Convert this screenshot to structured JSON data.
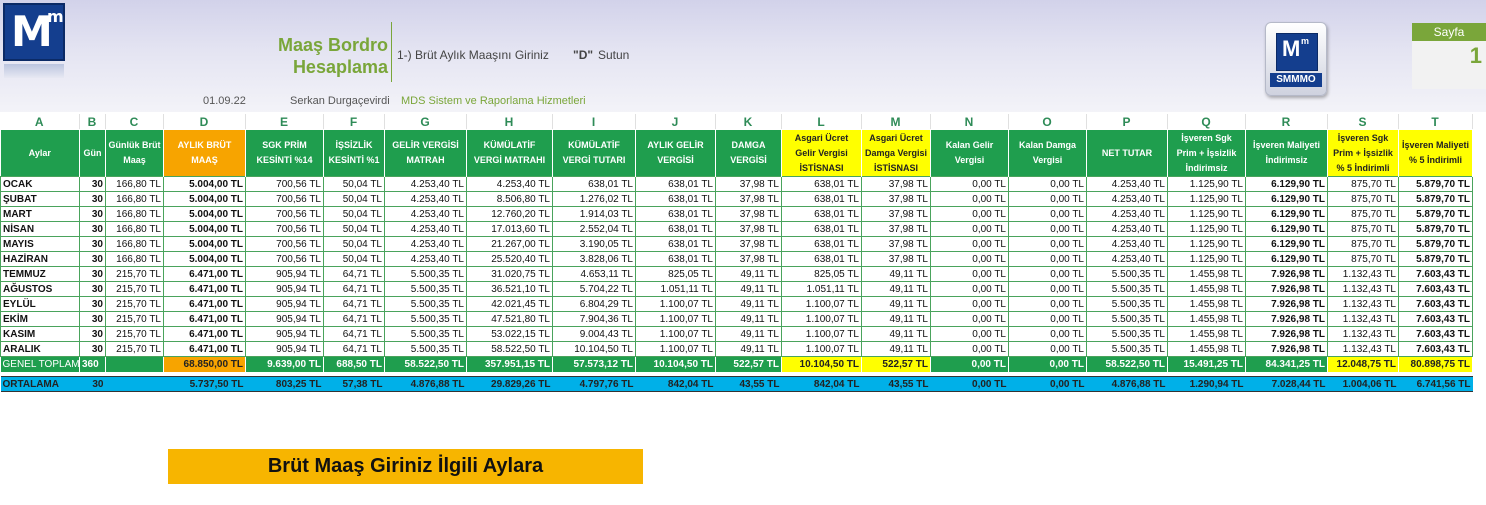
{
  "header": {
    "title_line1": "Maaş Bordro",
    "title_line2": "Hesaplama",
    "instruction": "1-) Brüt Aylık Maaşını Giriniz",
    "instruction_col": "\"D\"",
    "instruction_suffix": "Sutun",
    "date": "01.09.22",
    "author": "Serkan Durgaçevirdi",
    "company": "MDS Sistem ve Raporlama Hizmetleri",
    "logo_text": "M",
    "logo_sup": "m",
    "logo2_text": "SMMMO",
    "page_label": "Sayfa",
    "page_number": "1"
  },
  "column_letters": [
    "A",
    "B",
    "C",
    "D",
    "E",
    "F",
    "G",
    "H",
    "I",
    "J",
    "K",
    "L",
    "M",
    "N",
    "O",
    "P",
    "Q",
    "R",
    "S",
    "T"
  ],
  "column_headers": [
    "Aylar",
    "Gün",
    "Günlük Brüt Maaş",
    "AYLIK BRÜT MAAŞ",
    "SGK PRİM KESİNTİ %14",
    "İŞSİZLİK KESİNTİ %1",
    "GELİR VERGİSİ MATRAH",
    "KÜMÜLATİF VERGİ MATRAHI",
    "KÜMÜLATİF VERGİ TUTARI",
    "AYLIK GELİR VERGİSİ",
    "DAMGA VERGİSİ",
    "Asgari Ücret Gelir Vergisi İSTİSNASI",
    "Asgari Ücret Damga Vergisi İSTİSNASI",
    "Kalan Gelir Vergisi",
    "Kalan Damga Vergisi",
    "NET TUTAR",
    "İşveren Sgk Prim + İşsizlik İndirimsiz",
    "İşveren Maliyeti İndirimsiz",
    "İşveren Sgk Prim + İşsizlik % 5 İndirimli",
    "İşveren Maliyeti % 5 İndirimli"
  ],
  "rows": [
    [
      "OCAK",
      "30",
      "166,80 TL",
      "5.004,00 TL",
      "700,56 TL",
      "50,04 TL",
      "4.253,40 TL",
      "4.253,40 TL",
      "638,01 TL",
      "638,01 TL",
      "37,98 TL",
      "638,01 TL",
      "37,98 TL",
      "0,00 TL",
      "0,00 TL",
      "4.253,40 TL",
      "1.125,90 TL",
      "6.129,90 TL",
      "875,70 TL",
      "5.879,70 TL"
    ],
    [
      "ŞUBAT",
      "30",
      "166,80 TL",
      "5.004,00 TL",
      "700,56 TL",
      "50,04 TL",
      "4.253,40 TL",
      "8.506,80 TL",
      "1.276,02 TL",
      "638,01 TL",
      "37,98 TL",
      "638,01 TL",
      "37,98 TL",
      "0,00 TL",
      "0,00 TL",
      "4.253,40 TL",
      "1.125,90 TL",
      "6.129,90 TL",
      "875,70 TL",
      "5.879,70 TL"
    ],
    [
      "MART",
      "30",
      "166,80 TL",
      "5.004,00 TL",
      "700,56 TL",
      "50,04 TL",
      "4.253,40 TL",
      "12.760,20 TL",
      "1.914,03 TL",
      "638,01 TL",
      "37,98 TL",
      "638,01 TL",
      "37,98 TL",
      "0,00 TL",
      "0,00 TL",
      "4.253,40 TL",
      "1.125,90 TL",
      "6.129,90 TL",
      "875,70 TL",
      "5.879,70 TL"
    ],
    [
      "NİSAN",
      "30",
      "166,80 TL",
      "5.004,00 TL",
      "700,56 TL",
      "50,04 TL",
      "4.253,40 TL",
      "17.013,60 TL",
      "2.552,04 TL",
      "638,01 TL",
      "37,98 TL",
      "638,01 TL",
      "37,98 TL",
      "0,00 TL",
      "0,00 TL",
      "4.253,40 TL",
      "1.125,90 TL",
      "6.129,90 TL",
      "875,70 TL",
      "5.879,70 TL"
    ],
    [
      "MAYIS",
      "30",
      "166,80 TL",
      "5.004,00 TL",
      "700,56 TL",
      "50,04 TL",
      "4.253,40 TL",
      "21.267,00 TL",
      "3.190,05 TL",
      "638,01 TL",
      "37,98 TL",
      "638,01 TL",
      "37,98 TL",
      "0,00 TL",
      "0,00 TL",
      "4.253,40 TL",
      "1.125,90 TL",
      "6.129,90 TL",
      "875,70 TL",
      "5.879,70 TL"
    ],
    [
      "HAZİRAN",
      "30",
      "166,80 TL",
      "5.004,00 TL",
      "700,56 TL",
      "50,04 TL",
      "4.253,40 TL",
      "25.520,40 TL",
      "3.828,06 TL",
      "638,01 TL",
      "37,98 TL",
      "638,01 TL",
      "37,98 TL",
      "0,00 TL",
      "0,00 TL",
      "4.253,40 TL",
      "1.125,90 TL",
      "6.129,90 TL",
      "875,70 TL",
      "5.879,70 TL"
    ],
    [
      "TEMMUZ",
      "30",
      "215,70 TL",
      "6.471,00 TL",
      "905,94 TL",
      "64,71 TL",
      "5.500,35 TL",
      "31.020,75 TL",
      "4.653,11 TL",
      "825,05 TL",
      "49,11 TL",
      "825,05 TL",
      "49,11 TL",
      "0,00 TL",
      "0,00 TL",
      "5.500,35 TL",
      "1.455,98 TL",
      "7.926,98 TL",
      "1.132,43 TL",
      "7.603,43 TL"
    ],
    [
      "AĞUSTOS",
      "30",
      "215,70 TL",
      "6.471,00 TL",
      "905,94 TL",
      "64,71 TL",
      "5.500,35 TL",
      "36.521,10 TL",
      "5.704,22 TL",
      "1.051,11 TL",
      "49,11 TL",
      "1.051,11 TL",
      "49,11 TL",
      "0,00 TL",
      "0,00 TL",
      "5.500,35 TL",
      "1.455,98 TL",
      "7.926,98 TL",
      "1.132,43 TL",
      "7.603,43 TL"
    ],
    [
      "EYLÜL",
      "30",
      "215,70 TL",
      "6.471,00 TL",
      "905,94 TL",
      "64,71 TL",
      "5.500,35 TL",
      "42.021,45 TL",
      "6.804,29 TL",
      "1.100,07 TL",
      "49,11 TL",
      "1.100,07 TL",
      "49,11 TL",
      "0,00 TL",
      "0,00 TL",
      "5.500,35 TL",
      "1.455,98 TL",
      "7.926,98 TL",
      "1.132,43 TL",
      "7.603,43 TL"
    ],
    [
      "EKİM",
      "30",
      "215,70 TL",
      "6.471,00 TL",
      "905,94 TL",
      "64,71 TL",
      "5.500,35 TL",
      "47.521,80 TL",
      "7.904,36 TL",
      "1.100,07 TL",
      "49,11 TL",
      "1.100,07 TL",
      "49,11 TL",
      "0,00 TL",
      "0,00 TL",
      "5.500,35 TL",
      "1.455,98 TL",
      "7.926,98 TL",
      "1.132,43 TL",
      "7.603,43 TL"
    ],
    [
      "KASIM",
      "30",
      "215,70 TL",
      "6.471,00 TL",
      "905,94 TL",
      "64,71 TL",
      "5.500,35 TL",
      "53.022,15 TL",
      "9.004,43 TL",
      "1.100,07 TL",
      "49,11 TL",
      "1.100,07 TL",
      "49,11 TL",
      "0,00 TL",
      "0,00 TL",
      "5.500,35 TL",
      "1.455,98 TL",
      "7.926,98 TL",
      "1.132,43 TL",
      "7.603,43 TL"
    ],
    [
      "ARALIK",
      "30",
      "215,70 TL",
      "6.471,00 TL",
      "905,94 TL",
      "64,71 TL",
      "5.500,35 TL",
      "58.522,50 TL",
      "10.104,50 TL",
      "1.100,07 TL",
      "49,11 TL",
      "1.100,07 TL",
      "49,11 TL",
      "0,00 TL",
      "0,00 TL",
      "5.500,35 TL",
      "1.455,98 TL",
      "7.926,98 TL",
      "1.132,43 TL",
      "7.603,43 TL"
    ]
  ],
  "total_row": [
    "GENEL TOPLAM",
    "360",
    "",
    "68.850,00 TL",
    "9.639,00 TL",
    "688,50 TL",
    "58.522,50 TL",
    "357.951,15 TL",
    "57.573,12 TL",
    "10.104,50 TL",
    "522,57 TL",
    "10.104,50 TL",
    "522,57 TL",
    "0,00 TL",
    "0,00 TL",
    "58.522,50 TL",
    "15.491,25 TL",
    "84.341,25 TL",
    "12.048,75 TL",
    "80.898,75 TL"
  ],
  "average_row": [
    "ORTALAMA",
    "30",
    "",
    "5.737,50 TL",
    "803,25 TL",
    "57,38 TL",
    "4.876,88 TL",
    "29.829,26 TL",
    "4.797,76 TL",
    "842,04 TL",
    "43,55 TL",
    "842,04 TL",
    "43,55 TL",
    "0,00 TL",
    "0,00 TL",
    "4.876,88 TL",
    "1.290,94 TL",
    "7.028,44 TL",
    "1.004,06 TL",
    "6.741,56 TL"
  ],
  "banner": "Brüt Maaş Giriniz İlgili Aylara",
  "colors": {
    "header_green": "#1f9e4e",
    "input_orange": "#f7a400",
    "highlight_yellow": "#ffff00",
    "average_blue": "#00b0e8",
    "title_green": "#7aa63a"
  }
}
